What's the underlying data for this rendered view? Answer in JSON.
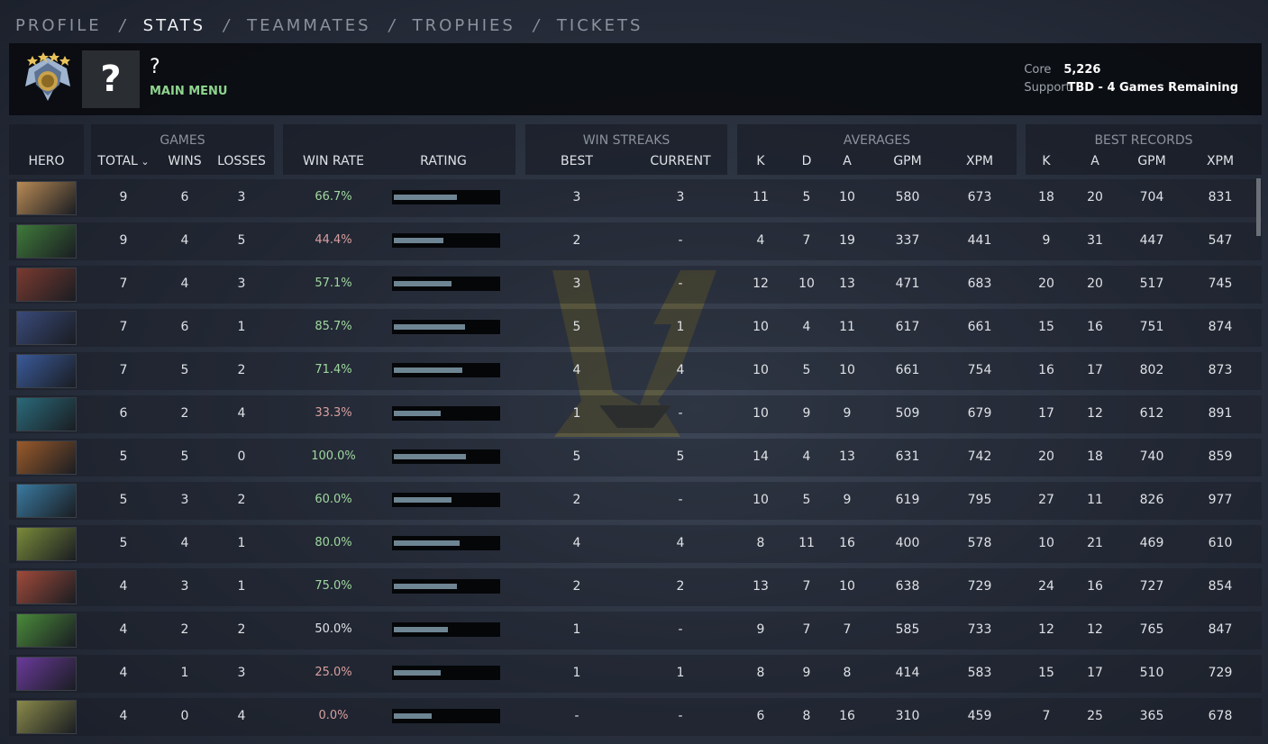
{
  "nav": {
    "items": [
      "PROFILE",
      "STATS",
      "TEAMMATES",
      "TROPHIES",
      "TICKETS"
    ],
    "active": "STATS",
    "separator": "/"
  },
  "header": {
    "player_name": "?",
    "avatar_glyph": "?",
    "main_menu": "MAIN MENU",
    "core_label": "Core",
    "core_value": "5,226",
    "support_label": "Support",
    "support_value": "TBD - 4 Games Remaining",
    "medal_icon": "rank-medal-icon"
  },
  "columns": {
    "groups": {
      "games": "GAMES",
      "win_streaks": "WIN STREAKS",
      "averages": "AVERAGES",
      "best_records": "BEST RECORDS"
    },
    "hero": "HERO",
    "total": "TOTAL",
    "wins": "WINS",
    "losses": "LOSSES",
    "win_rate": "WIN RATE",
    "rating": "RATING",
    "best": "BEST",
    "current": "CURRENT",
    "k": "K",
    "d": "D",
    "a": "A",
    "gpm": "GPM",
    "xpm": "XPM",
    "best_k": "K",
    "best_a": "A",
    "best_gpm": "GPM",
    "best_xpm": "XPM"
  },
  "colors": {
    "win_rate_good": "#9fd89f",
    "win_rate_bad": "#d8a0a0",
    "rating_fill": "#6e8593",
    "hero_colors": [
      "#b88a55",
      "#3f7a3a",
      "#7a3a30",
      "#3a4a7a",
      "#3a5a9a",
      "#2a6a7a",
      "#9a5a2a",
      "#3a7aa0",
      "#7a8a3a",
      "#a04a3a",
      "#4a8a3a",
      "#6a3a9a",
      "#8a8a4a"
    ]
  },
  "rows": [
    {
      "total": "9",
      "wins": "6",
      "losses": "3",
      "win_rate": "66.7%",
      "tone": "good",
      "rating": 0.58,
      "best": "3",
      "current": "3",
      "k": "11",
      "d": "5",
      "a": "10",
      "gpm": "580",
      "xpm": "673",
      "bk": "18",
      "ba": "20",
      "bgpm": "704",
      "bxpm": "831"
    },
    {
      "total": "9",
      "wins": "4",
      "losses": "5",
      "win_rate": "44.4%",
      "tone": "bad",
      "rating": 0.46,
      "best": "2",
      "current": "-",
      "k": "4",
      "d": "7",
      "a": "19",
      "gpm": "337",
      "xpm": "441",
      "bk": "9",
      "ba": "31",
      "bgpm": "447",
      "bxpm": "547"
    },
    {
      "total": "7",
      "wins": "4",
      "losses": "3",
      "win_rate": "57.1%",
      "tone": "good",
      "rating": 0.53,
      "best": "3",
      "current": "-",
      "k": "12",
      "d": "10",
      "a": "13",
      "gpm": "471",
      "xpm": "683",
      "bk": "20",
      "ba": "20",
      "bgpm": "517",
      "bxpm": "745"
    },
    {
      "total": "7",
      "wins": "6",
      "losses": "1",
      "win_rate": "85.7%",
      "tone": "good",
      "rating": 0.66,
      "best": "5",
      "current": "1",
      "k": "10",
      "d": "4",
      "a": "11",
      "gpm": "617",
      "xpm": "661",
      "bk": "15",
      "ba": "16",
      "bgpm": "751",
      "bxpm": "874"
    },
    {
      "total": "7",
      "wins": "5",
      "losses": "2",
      "win_rate": "71.4%",
      "tone": "good",
      "rating": 0.63,
      "best": "4",
      "current": "4",
      "k": "10",
      "d": "5",
      "a": "10",
      "gpm": "661",
      "xpm": "754",
      "bk": "16",
      "ba": "17",
      "bgpm": "802",
      "bxpm": "873"
    },
    {
      "total": "6",
      "wins": "2",
      "losses": "4",
      "win_rate": "33.3%",
      "tone": "bad",
      "rating": 0.43,
      "best": "1",
      "current": "-",
      "k": "10",
      "d": "9",
      "a": "9",
      "gpm": "509",
      "xpm": "679",
      "bk": "17",
      "ba": "12",
      "bgpm": "612",
      "bxpm": "891"
    },
    {
      "total": "5",
      "wins": "5",
      "losses": "0",
      "win_rate": "100.0%",
      "tone": "good",
      "rating": 0.67,
      "best": "5",
      "current": "5",
      "k": "14",
      "d": "4",
      "a": "13",
      "gpm": "631",
      "xpm": "742",
      "bk": "20",
      "ba": "18",
      "bgpm": "740",
      "bxpm": "859"
    },
    {
      "total": "5",
      "wins": "3",
      "losses": "2",
      "win_rate": "60.0%",
      "tone": "good",
      "rating": 0.53,
      "best": "2",
      "current": "-",
      "k": "10",
      "d": "5",
      "a": "9",
      "gpm": "619",
      "xpm": "795",
      "bk": "27",
      "ba": "11",
      "bgpm": "826",
      "bxpm": "977"
    },
    {
      "total": "5",
      "wins": "4",
      "losses": "1",
      "win_rate": "80.0%",
      "tone": "good",
      "rating": 0.61,
      "best": "4",
      "current": "4",
      "k": "8",
      "d": "11",
      "a": "16",
      "gpm": "400",
      "xpm": "578",
      "bk": "10",
      "ba": "21",
      "bgpm": "469",
      "bxpm": "610"
    },
    {
      "total": "4",
      "wins": "3",
      "losses": "1",
      "win_rate": "75.0%",
      "tone": "good",
      "rating": 0.58,
      "best": "2",
      "current": "2",
      "k": "13",
      "d": "7",
      "a": "10",
      "gpm": "638",
      "xpm": "729",
      "bk": "24",
      "ba": "16",
      "bgpm": "727",
      "bxpm": "854"
    },
    {
      "total": "4",
      "wins": "2",
      "losses": "2",
      "win_rate": "50.0%",
      "tone": "neutral",
      "rating": 0.5,
      "best": "1",
      "current": "-",
      "k": "9",
      "d": "7",
      "a": "7",
      "gpm": "585",
      "xpm": "733",
      "bk": "12",
      "ba": "12",
      "bgpm": "765",
      "bxpm": "847"
    },
    {
      "total": "4",
      "wins": "1",
      "losses": "3",
      "win_rate": "25.0%",
      "tone": "bad",
      "rating": 0.43,
      "best": "1",
      "current": "1",
      "k": "8",
      "d": "9",
      "a": "8",
      "gpm": "414",
      "xpm": "583",
      "bk": "15",
      "ba": "17",
      "bgpm": "510",
      "bxpm": "729"
    },
    {
      "total": "4",
      "wins": "0",
      "losses": "4",
      "win_rate": "0.0%",
      "tone": "bad",
      "rating": 0.35,
      "best": "-",
      "current": "-",
      "k": "6",
      "d": "8",
      "a": "16",
      "gpm": "310",
      "xpm": "459",
      "bk": "7",
      "ba": "25",
      "bgpm": "365",
      "bxpm": "678"
    }
  ]
}
